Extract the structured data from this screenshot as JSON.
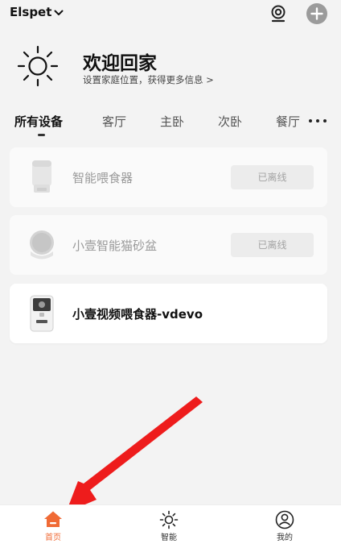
{
  "header": {
    "home_name": "Elspet",
    "icons": {
      "dropdown": "chevron-down-icon",
      "camera": "camera-icon",
      "add": "plus-circle-icon"
    }
  },
  "welcome": {
    "title": "欢迎回家",
    "subtitle": "设置家庭位置，获得更多信息 >",
    "icon": "sun-icon"
  },
  "tabs": [
    {
      "label": "所有设备",
      "active": true
    },
    {
      "label": "客厅",
      "active": false
    },
    {
      "label": "主卧",
      "active": false
    },
    {
      "label": "次卧",
      "active": false
    },
    {
      "label": "餐厅",
      "active": false
    }
  ],
  "tabs_more_icon": "more-horizontal-icon",
  "devices": [
    {
      "name": "智能喂食器",
      "status": "已离线",
      "online": false,
      "icon": "feeder-device-icon"
    },
    {
      "name": "小壹智能猫砂盆",
      "status": "已离线",
      "online": false,
      "icon": "litter-box-device-icon"
    },
    {
      "name": "小壹视频喂食器-vdevo",
      "status": "",
      "online": true,
      "icon": "video-feeder-device-icon"
    }
  ],
  "bottom_nav": [
    {
      "label": "首页",
      "icon": "home-icon",
      "active": true
    },
    {
      "label": "智能",
      "icon": "sun-icon",
      "active": false
    },
    {
      "label": "我的",
      "icon": "user-icon",
      "active": false
    }
  ],
  "colors": {
    "accent": "#f06a35",
    "annotation_arrow": "#ee1c1c",
    "background": "#f3f3f3",
    "offline_badge": "#ececec",
    "add_button": "#9b9b9b"
  }
}
